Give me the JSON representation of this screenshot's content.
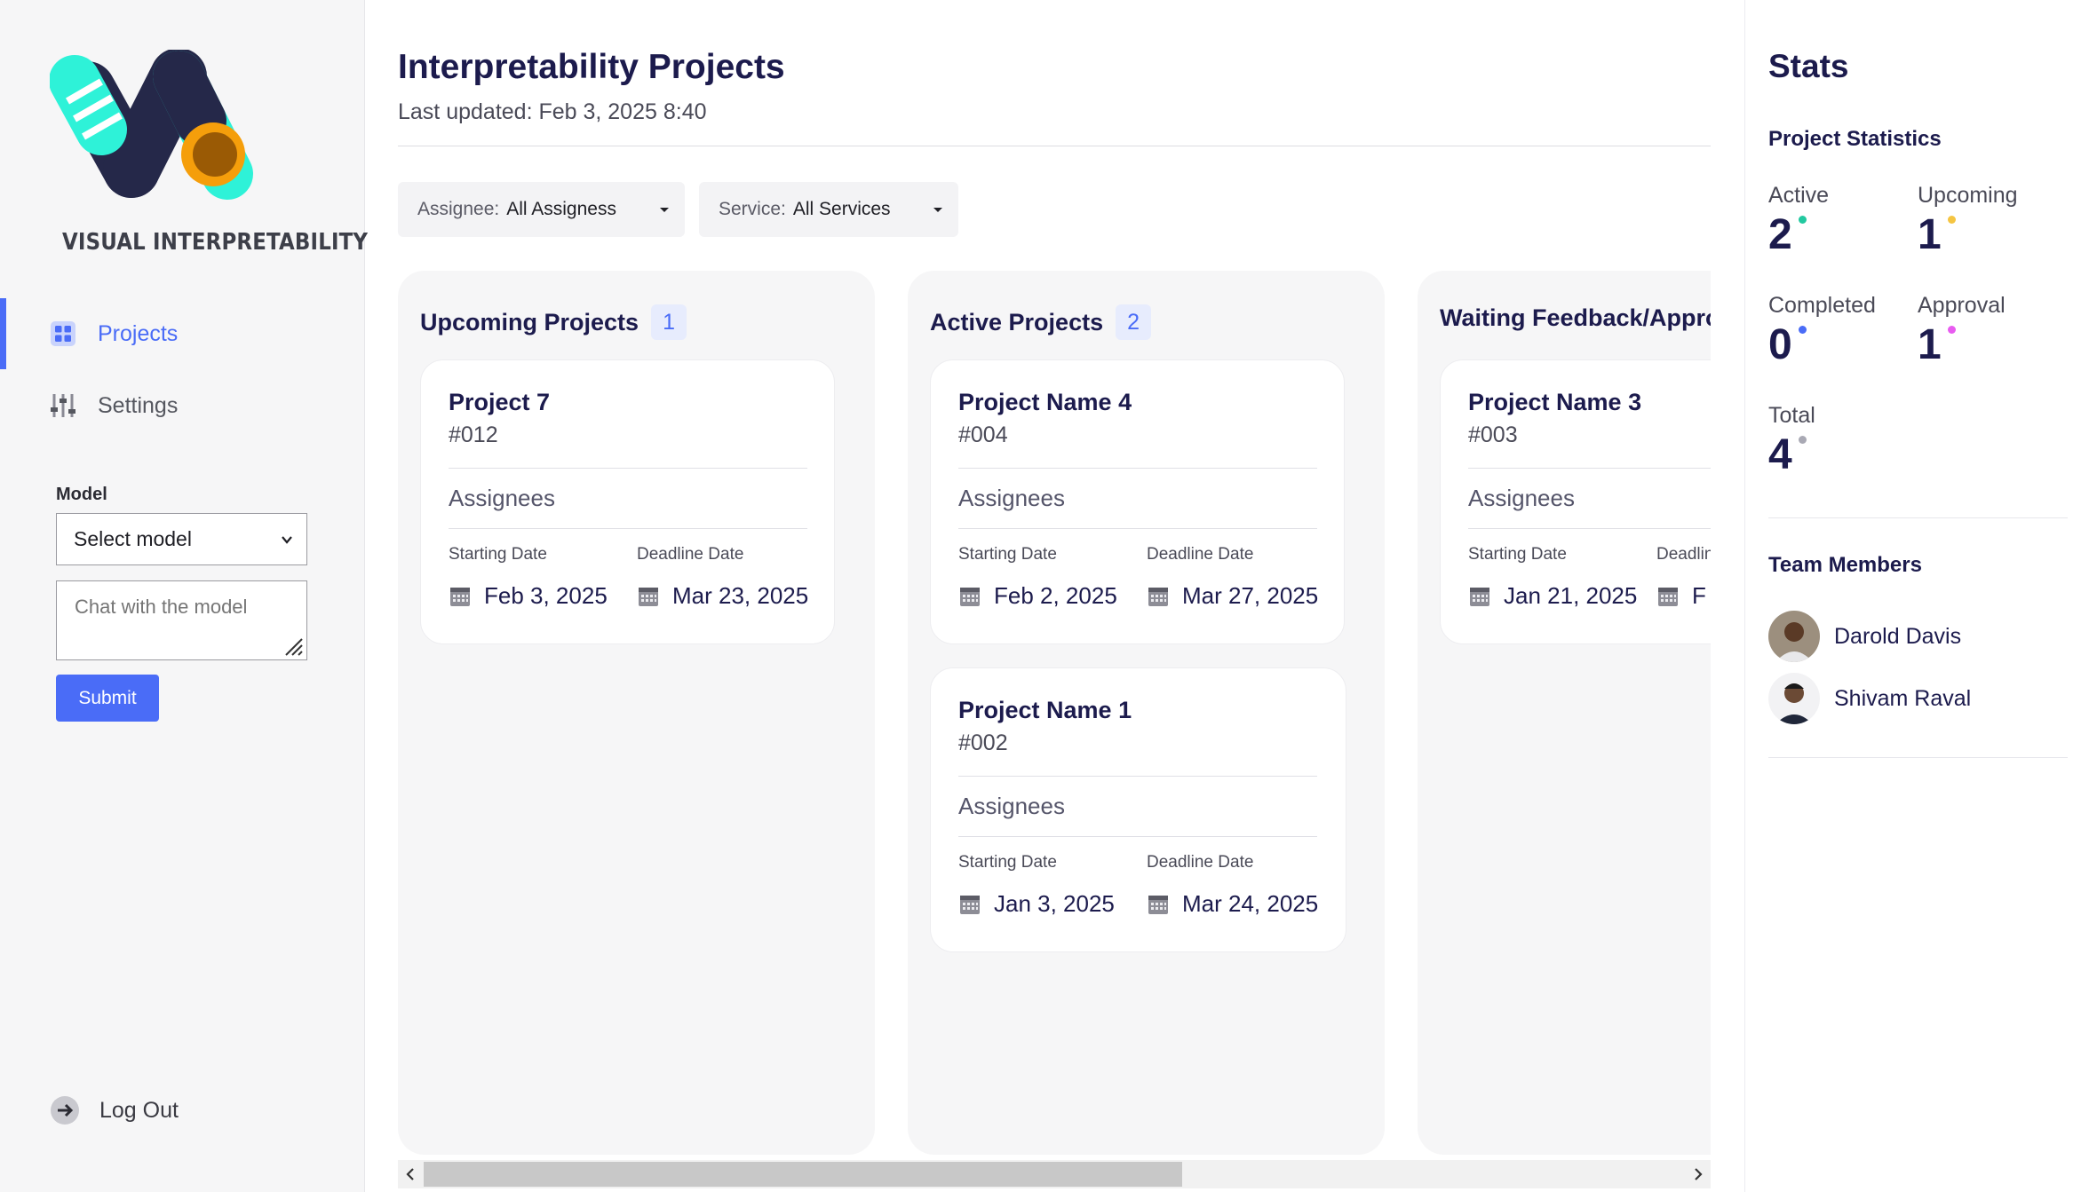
{
  "sidebar": {
    "logo_text": "VISUAL INTERPRETABILITY",
    "nav": [
      {
        "label": "Projects",
        "icon": "grid-icon",
        "active": true
      },
      {
        "label": "Settings",
        "icon": "sliders-icon",
        "active": false
      }
    ],
    "model_label": "Model",
    "model_select_value": "Select model",
    "chat_placeholder": "Chat with the model",
    "submit_label": "Submit",
    "logout_label": "Log Out"
  },
  "header": {
    "title": "Interpretability Projects",
    "last_updated": "Last updated: Feb 3, 2025 8:40"
  },
  "filters": {
    "assignee_label": "Assignee:",
    "assignee_value": "All Assigness",
    "service_label": "Service:",
    "service_value": "All Services"
  },
  "columns": [
    {
      "title": "Upcoming Projects",
      "count": "1",
      "cards": [
        {
          "name": "Project 7",
          "id": "#012",
          "assignees_label": "Assignees",
          "start_label": "Starting Date",
          "start": "Feb 3, 2025",
          "deadline_label": "Deadline Date",
          "deadline": "Mar 23, 2025"
        }
      ]
    },
    {
      "title": "Active Projects",
      "count": "2",
      "cards": [
        {
          "name": "Project Name 4",
          "id": "#004",
          "assignees_label": "Assignees",
          "start_label": "Starting Date",
          "start": "Feb 2, 2025",
          "deadline_label": "Deadline Date",
          "deadline": "Mar 27, 2025"
        },
        {
          "name": "Project Name 1",
          "id": "#002",
          "assignees_label": "Assignees",
          "start_label": "Starting Date",
          "start": "Jan 3, 2025",
          "deadline_label": "Deadline Date",
          "deadline": "Mar 24, 2025"
        }
      ]
    },
    {
      "title": "Waiting Feedback/Approval",
      "count": "",
      "cards": [
        {
          "name": "Project Name 3",
          "id": "#003",
          "assignees_label": "Assignees",
          "start_label": "Starting Date",
          "start": "Jan 21, 2025",
          "deadline_label": "Deadline Date",
          "deadline": "F"
        }
      ]
    }
  ],
  "stats": {
    "title": "Stats",
    "project_stats_title": "Project Statistics",
    "items": [
      {
        "label": "Active",
        "value": "2",
        "dot_color": "#22c9a0"
      },
      {
        "label": "Upcoming",
        "value": "1",
        "dot_color": "#f5c542"
      },
      {
        "label": "Completed",
        "value": "0",
        "dot_color": "#4a6cf7"
      },
      {
        "label": "Approval",
        "value": "1",
        "dot_color": "#e85cf0"
      },
      {
        "label": "Total",
        "value": "4",
        "dot_color": "#a9a9b4"
      }
    ],
    "team_title": "Team Members",
    "members": [
      {
        "name": "Darold Davis"
      },
      {
        "name": "Shivam Raval"
      }
    ]
  },
  "scrollbar": {
    "thumb_position_fraction": 0.0,
    "visible_fraction": 0.58
  },
  "colors": {
    "accent": "#4a6cf7",
    "navy": "#1c1b4d",
    "logo_teal": "#2ef2d8",
    "logo_orange": "#f59e0b"
  }
}
